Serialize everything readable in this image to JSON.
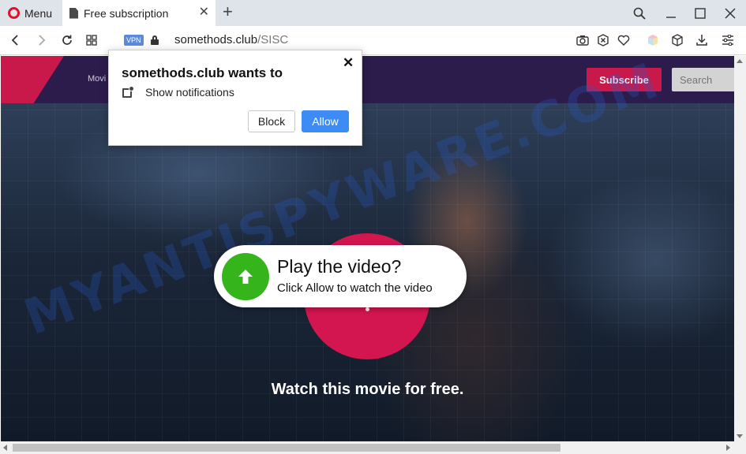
{
  "browser": {
    "menu_label": "Menu",
    "tab_title": "Free subscription",
    "vpn_label": "VPN",
    "url_domain": "somethods.club",
    "url_path": "/SISC"
  },
  "site": {
    "nav_label": "Movi",
    "subscribe_label": "Subscribe",
    "search_placeholder": "Search",
    "play_title": "Play the video?",
    "play_subtitle": "Click Allow to watch the video",
    "watch_text": "Watch this movie for free.",
    "watermark": "MYANTISPYWARE.COM"
  },
  "popup": {
    "title": "somethods.club wants to",
    "permission": "Show notifications",
    "close_glyph": "✕",
    "block_label": "Block",
    "allow_label": "Allow"
  },
  "colors": {
    "accent_red": "#c8194a",
    "play_red": "#d3164f",
    "arrow_green": "#35b41c",
    "allow_blue": "#3d8cf5",
    "header_purple": "#2c1c4c"
  }
}
